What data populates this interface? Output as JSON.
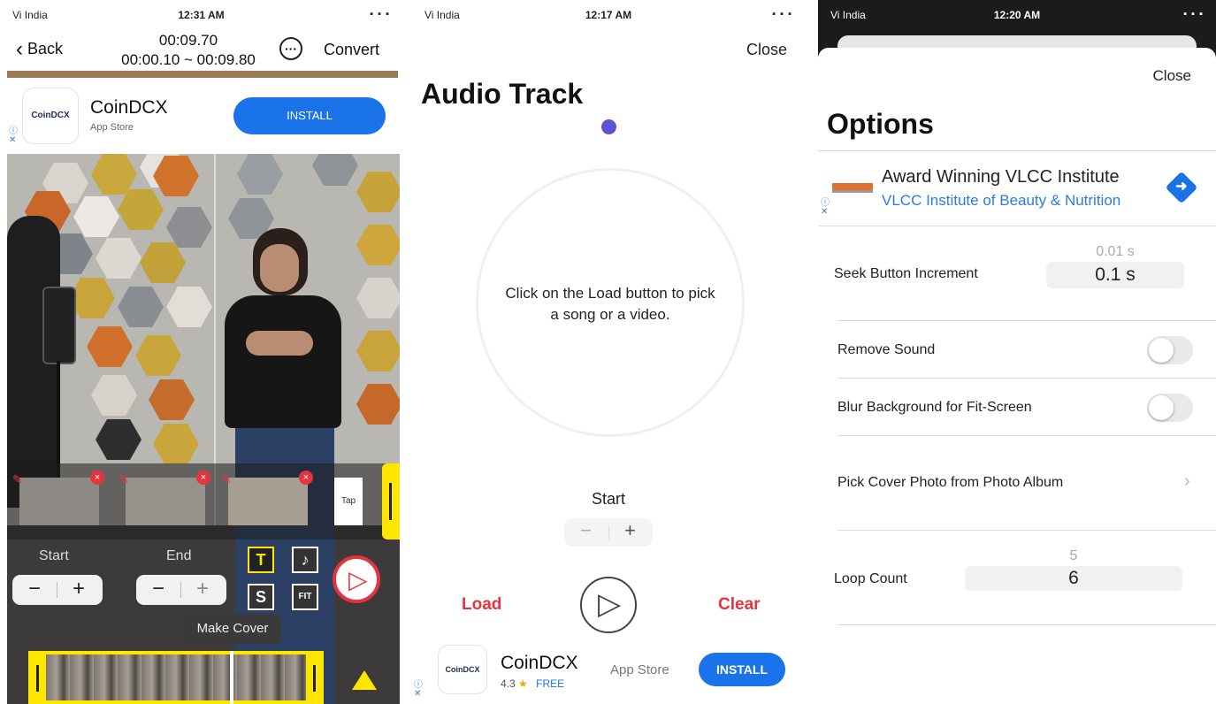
{
  "panel1": {
    "status": {
      "carrier": "Vi India",
      "time": "12:31 AM",
      "battery": "▪ ▪ ▪"
    },
    "nav": {
      "back": "Back",
      "duration": "00:09.70",
      "range": "00:00.10 ~ 00:09.80",
      "convert": "Convert"
    },
    "ad": {
      "logo_text": "CoinDCX",
      "title": "CoinDCX",
      "subtitle": "App Store",
      "install": "INSTALL"
    },
    "clip_tag_text": "Tap",
    "controls": {
      "start_label": "Start",
      "end_label": "End",
      "minus": "−",
      "plus": "+",
      "tool_text": "T",
      "tool_music": "♪",
      "tool_s": "S",
      "tool_fit": "FIT",
      "make_cover": "Make Cover"
    }
  },
  "panel2": {
    "status": {
      "carrier": "Vi India",
      "time": "12:17 AM",
      "battery": "▪ ▪ ▪"
    },
    "close": "Close",
    "title": "Audio Track",
    "message": "Click on the Load button to pick a song or a video.",
    "start_label": "Start",
    "minus": "−",
    "plus": "+",
    "load": "Load",
    "clear": "Clear",
    "ad": {
      "logo_text": "CoinDCX",
      "title": "CoinDCX",
      "rating": "4.3",
      "star": "★",
      "price": "FREE",
      "store": "App Store",
      "install": "INSTALL"
    }
  },
  "panel3": {
    "status": {
      "carrier": "Vi India",
      "time": "12:20 AM",
      "battery": "▪ ▪ ▪"
    },
    "close": "Close",
    "title": "Options",
    "ad": {
      "title": "Award Winning VLCC Institute",
      "subtitle": "VLCC Institute of Beauty & Nutrition"
    },
    "seek": {
      "label": "Seek Button Increment",
      "prev_value": "0.01 s",
      "value": "0.1 s"
    },
    "remove_sound": {
      "label": "Remove Sound",
      "on": false
    },
    "blur_bg": {
      "label": "Blur Background for Fit-Screen",
      "on": false
    },
    "cover_photo": {
      "label": "Pick Cover Photo from Photo Album",
      "chevron": "›"
    },
    "loop": {
      "label": "Loop Count",
      "prev_value": "5",
      "value": "6"
    }
  },
  "colors": {
    "accent_blue": "#1a73e8",
    "red": "#e5343d",
    "yellow": "#ffe600",
    "purple_dot": "#5b55d6"
  }
}
